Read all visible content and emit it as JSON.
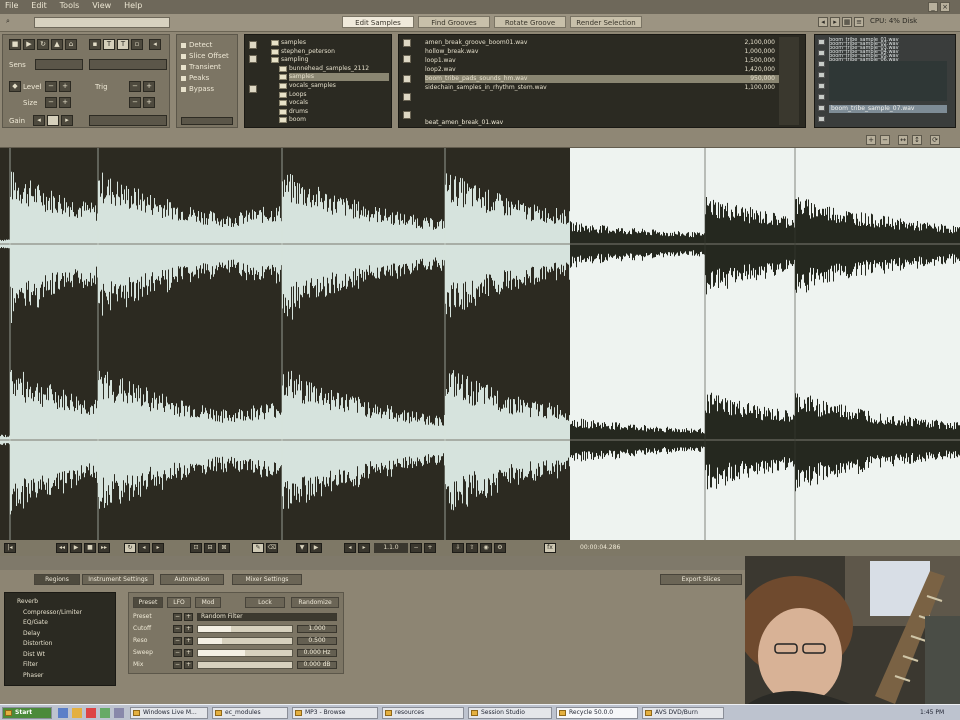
{
  "menu": {
    "items": [
      "File",
      "Edit",
      "Tools",
      "View",
      "Help"
    ]
  },
  "title_strip": {
    "tabs": [
      {
        "label": "Edit Samples",
        "active": true
      },
      {
        "label": "Find Grooves",
        "active": false
      },
      {
        "label": "Rotate Groove",
        "active": false
      },
      {
        "label": "Render Selection",
        "active": false
      }
    ],
    "right_label": "CPU: 4%   Disk"
  },
  "left_panel": {
    "rows": [
      {
        "label": "Sens",
        "value": ""
      },
      {
        "label": "Level",
        "value": ""
      },
      {
        "label": "Trig",
        "value": ""
      },
      {
        "label": "Size",
        "value": ""
      }
    ],
    "options": [
      "Detect",
      "Slice Offset",
      "Transient",
      "Peaks",
      "Bypass"
    ],
    "gain_label": "Gain"
  },
  "tree": {
    "items": [
      {
        "label": "samples",
        "indent": 2
      },
      {
        "label": "stephen_peterson",
        "indent": 2
      },
      {
        "label": "sampling",
        "indent": 2
      },
      {
        "label": "bunnehead_samples_2112",
        "indent": 3
      },
      {
        "label": "samples",
        "indent": 3,
        "selected": true
      },
      {
        "label": "vocals_samples",
        "indent": 3
      },
      {
        "label": "Loops",
        "indent": 3
      },
      {
        "label": "vocals",
        "indent": 3
      },
      {
        "label": "drums",
        "indent": 3
      },
      {
        "label": "boom",
        "indent": 3
      }
    ]
  },
  "file_list": {
    "rows": [
      {
        "name": "amen_break_groove_boom01.wav",
        "length": "2,100,000"
      },
      {
        "name": "hollow_break.wav",
        "length": "1,000,000"
      },
      {
        "name": "loop1.wav",
        "length": "1,500,000"
      },
      {
        "name": "loop2.wav",
        "length": "1,420,000"
      },
      {
        "name": "boom_tribe_pads_sounds_hm.wav",
        "length": "950,000",
        "selected": true
      },
      {
        "name": "sidechain_samples_in_rhythm_stem.wav",
        "length": "1,100,000"
      }
    ],
    "footer": "beat_amen_break_01.wav"
  },
  "right_list": {
    "rows": [
      "boom_tribe_sample_01.wav",
      "boom_tribe_sample_02.wav",
      "boom_tribe_sample_03.wav",
      "boom_tribe_sample_04.wav",
      "boom_tribe_sample_05.wav",
      "boom_tribe_sample_06.wav"
    ],
    "footer_selected": "boom_tribe_sample_07.wav"
  },
  "transport": {
    "position": "1.1.0",
    "status": "00:00:04.286"
  },
  "bottom_tabs": [
    {
      "label": "Regions",
      "active": true
    },
    {
      "label": "Instrument Settings",
      "active": false
    },
    {
      "label": "Automation",
      "active": false
    },
    {
      "label": "Mixer Settings",
      "active": false
    }
  ],
  "bottom_right_button": "Export Slices",
  "effects_list": [
    "Reverb",
    "Compressor/Limiter",
    "EQ/Gate",
    "Delay",
    "Distortion",
    "Dist Wt",
    "Filter",
    "Phaser"
  ],
  "fx_panel": {
    "tabs": [
      "Preset",
      "LFO",
      "Mod"
    ],
    "buttons": [
      "Lock",
      "Randomize"
    ],
    "rows": [
      {
        "label": "Preset",
        "type": "select",
        "value": "Random Filter"
      },
      {
        "label": "Cutoff",
        "type": "slider",
        "fraction": 0.35,
        "value": "1.000"
      },
      {
        "label": "Reso",
        "type": "slider",
        "fraction": 0.25,
        "value": "0.500"
      },
      {
        "label": "Sweep",
        "type": "slider",
        "fraction": 0.5,
        "value": "0.000 Hz"
      },
      {
        "label": "Mix",
        "type": "slider",
        "fraction": 0.0,
        "value": "0.000 dB"
      }
    ]
  },
  "taskbar": {
    "start": "Start",
    "tasks": [
      {
        "label": "Windows Live M...",
        "active": false
      },
      {
        "label": "ec_modules",
        "active": false
      },
      {
        "label": "MP3 - Browse",
        "active": false
      },
      {
        "label": "resources",
        "active": false
      },
      {
        "label": "Session Studio",
        "active": false
      },
      {
        "label": "Recycle 50.0.0",
        "active": true
      },
      {
        "label": "AVS DVD/Burn",
        "active": false
      }
    ],
    "clock": "1:45 PM"
  },
  "colors": {
    "wave_dark_bg": "#2c2a21",
    "wave_dark_fg": "#d6e3dd",
    "wave_light_bg": "#eef3f0",
    "wave_light_fg": "#25281f",
    "selection_split_fraction": 0.594
  }
}
